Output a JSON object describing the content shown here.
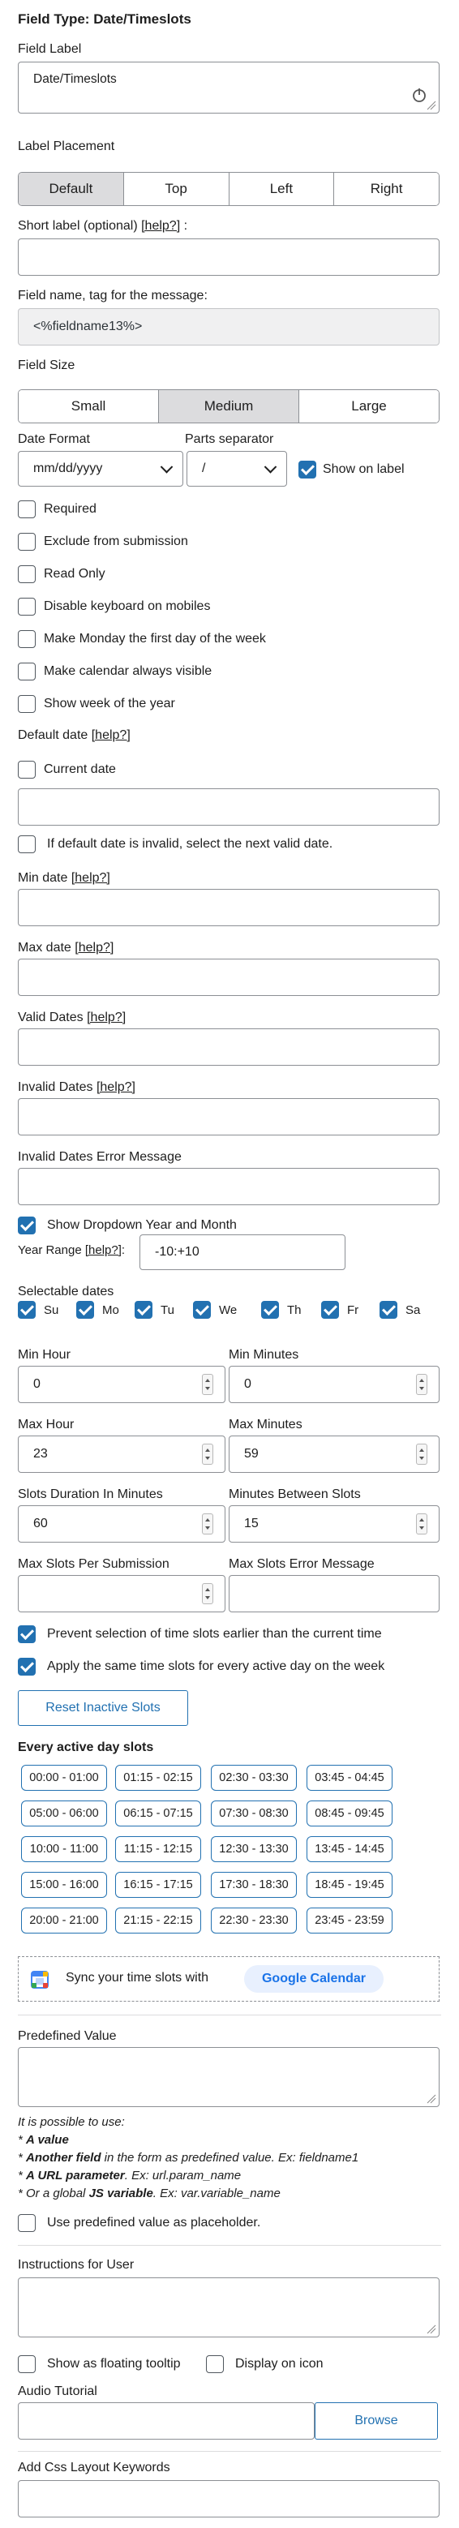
{
  "title": "Field Type: Date/Timeslots",
  "field_label": {
    "label": "Field Label",
    "value": "Date/Timeslots"
  },
  "label_placement": {
    "label": "Label Placement",
    "options": [
      "Default",
      "Top",
      "Left",
      "Right"
    ],
    "selected": "Default"
  },
  "short_label": {
    "label": "Short label (optional)",
    "help": "[help?]",
    "suffix": ":"
  },
  "field_name": {
    "label": "Field name, tag for the message:",
    "value": "<%fieldname13%>"
  },
  "field_size": {
    "label": "Field Size",
    "options": [
      "Small",
      "Medium",
      "Large"
    ],
    "selected": "Medium"
  },
  "date_format": {
    "label": "Date Format",
    "value": "mm/dd/yyyy"
  },
  "parts_separator": {
    "label": "Parts separator",
    "value": "/"
  },
  "show_on_label": {
    "label": "Show on label",
    "checked": true
  },
  "options": {
    "required": "Required",
    "exclude": "Exclude from submission",
    "readonly": "Read Only",
    "disable_keyboard": "Disable keyboard on mobiles",
    "monday_first": "Make Monday the first day of the week",
    "always_visible": "Make calendar always visible",
    "week_of_year": "Show week of the year"
  },
  "default_date": {
    "label": "Default date",
    "help": "[help?]",
    "current_date": "Current date",
    "next_valid": "If default date is invalid, select the next valid date."
  },
  "min_date": {
    "label": "Min date",
    "help": "[help?]"
  },
  "max_date": {
    "label": "Max date",
    "help": "[help?]"
  },
  "valid_dates": {
    "label": "Valid Dates",
    "help": "[help?]"
  },
  "invalid_dates": {
    "label": "Invalid Dates",
    "help": "[help?]"
  },
  "invalid_dates_error": {
    "label": "Invalid Dates Error Message"
  },
  "dropdown_year_month": {
    "label": "Show Dropdown Year and Month",
    "checked": true
  },
  "year_range": {
    "label": "Year Range",
    "help": "[help?]",
    "suffix": ":",
    "value": "-10:+10"
  },
  "selectable_dates": {
    "label": "Selectable dates",
    "days": [
      "Su",
      "Mo",
      "Tu",
      "We",
      "Th",
      "Fr",
      "Sa"
    ]
  },
  "min_hour": {
    "label": "Min Hour",
    "value": "0"
  },
  "min_minutes": {
    "label": "Min Minutes",
    "value": "0"
  },
  "max_hour": {
    "label": "Max Hour",
    "value": "23"
  },
  "max_minutes": {
    "label": "Max Minutes",
    "value": "59"
  },
  "slots_duration": {
    "label": "Slots Duration In Minutes",
    "value": "60"
  },
  "minutes_between": {
    "label": "Minutes Between Slots",
    "value": "15"
  },
  "max_slots": {
    "label": "Max Slots Per Submission",
    "value": ""
  },
  "max_slots_error": {
    "label": "Max Slots Error Message",
    "value": ""
  },
  "prevent_earlier": {
    "label": "Prevent selection of time slots earlier than the current time",
    "checked": true
  },
  "same_slots": {
    "label": "Apply the same time slots for every active day on the week",
    "checked": true
  },
  "reset_button": "Reset Inactive Slots",
  "every_active_day": {
    "label": "Every active day slots",
    "slots": [
      "00:00 - 01:00",
      "01:15 - 02:15",
      "02:30 - 03:30",
      "03:45 - 04:45",
      "05:00 - 06:00",
      "06:15 - 07:15",
      "07:30 - 08:30",
      "08:45 - 09:45",
      "10:00 - 11:00",
      "11:15 - 12:15",
      "12:30 - 13:30",
      "13:45 - 14:45",
      "15:00 - 16:00",
      "16:15 - 17:15",
      "17:30 - 18:30",
      "18:45 - 19:45",
      "20:00 - 21:00",
      "21:15 - 22:15",
      "22:30 - 23:30",
      "23:45 - 23:59"
    ]
  },
  "sync": {
    "text": "Sync your time slots with",
    "button": "Google Calendar"
  },
  "predefined": {
    "label": "Predefined Value",
    "note_intro": "It is possible to use:",
    "note_1_bold": "A value",
    "note_2_bold": "Another field",
    "note_2_rest": " in the form as predefined value. Ex: fieldname1",
    "note_3_bold": "A URL parameter",
    "note_3_rest": ". Ex: url.param_name",
    "note_4_pre": "Or a global ",
    "note_4_bold": "JS variable",
    "note_4_rest": ". Ex: var.variable_name",
    "placeholder_option": "Use predefined value as placeholder."
  },
  "instructions": {
    "label": "Instructions for User"
  },
  "floating_tooltip": "Show as floating tooltip",
  "display_on_icon": "Display on icon",
  "audio_tutorial": {
    "label": "Audio Tutorial",
    "browse": "Browse"
  },
  "css_keywords": {
    "label": "Add Css Layout Keywords"
  },
  "colors": {
    "accent": "#2271b1",
    "google_pill": "#e8f0fe"
  }
}
